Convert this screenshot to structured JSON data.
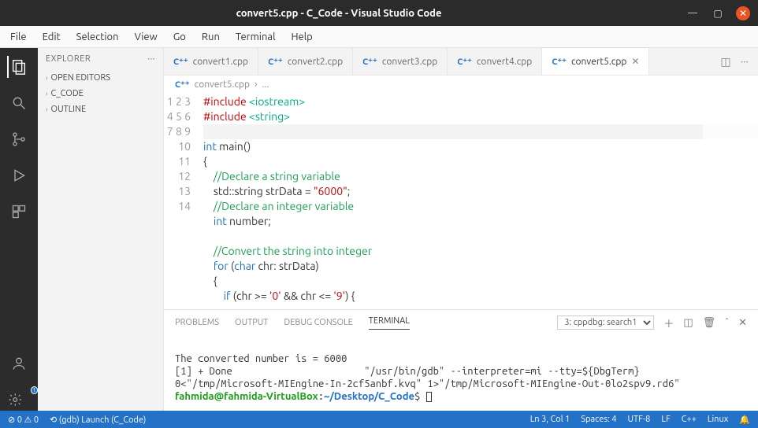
{
  "window": {
    "title": "convert5.cpp - C_Code - Visual Studio Code"
  },
  "menu": [
    "File",
    "Edit",
    "Selection",
    "View",
    "Go",
    "Run",
    "Terminal",
    "Help"
  ],
  "explorer": {
    "title": "EXPLORER",
    "sections": [
      "OPEN EDITORS",
      "C_CODE",
      "OUTLINE"
    ]
  },
  "tabs": [
    {
      "label": "convert1.cpp",
      "active": false
    },
    {
      "label": "convert2.cpp",
      "active": false
    },
    {
      "label": "convert3.cpp",
      "active": false
    },
    {
      "label": "convert4.cpp",
      "active": false
    },
    {
      "label": "convert5.cpp",
      "active": true
    }
  ],
  "breadcrumb": {
    "file": "convert5.cpp",
    "sep": "›",
    "rest": "..."
  },
  "code_lines": [
    {
      "n": 1,
      "html": "<span class='k-pre'>#include</span> <span class='k-incstr'>&lt;iostream&gt;</span>"
    },
    {
      "n": 2,
      "html": "<span class='k-pre'>#include</span> <span class='k-incstr'>&lt;string&gt;</span>"
    },
    {
      "n": 3,
      "html": "<span class='cur-line'>&#8203;</span>"
    },
    {
      "n": 4,
      "html": "<span class='k-type'>int</span> main()"
    },
    {
      "n": 5,
      "html": "{"
    },
    {
      "n": 6,
      "html": "    <span class='k-com'>//Declare a string variable</span>"
    },
    {
      "n": 7,
      "html": "    std::string strData = <span class='k-str'>\"6000\"</span>;"
    },
    {
      "n": 8,
      "html": "    <span class='k-com'>//Declare an integer variable</span>"
    },
    {
      "n": 9,
      "html": "    <span class='k-type'>int</span> number;"
    },
    {
      "n": 10,
      "html": ""
    },
    {
      "n": 11,
      "html": "    <span class='k-com'>//Convert the string into integer</span>"
    },
    {
      "n": 12,
      "html": "    <span class='k-type'>for</span> (<span class='k-type'>char</span> chr: strData)"
    },
    {
      "n": 13,
      "html": "    {"
    },
    {
      "n": 14,
      "html": "        <span class='k-type'>if</span> (chr &gt;= <span class='k-chr'>'0'</span> &amp;&amp; chr &lt;= <span class='k-chr'>'9'</span>) {"
    }
  ],
  "panel": {
    "tabs": [
      "PROBLEMS",
      "OUTPUT",
      "DEBUG CONSOLE",
      "TERMINAL"
    ],
    "active_tab": "TERMINAL",
    "selector": "3: cppdbg: search1",
    "terminal_lines": [
      "",
      "The converted number is = 6000",
      "[1] + Done                       \"/usr/bin/gdb\" --interpreter=mi --tty=${DbgTerm} 0<\"/tmp/Microsoft-MIEngine-In-2cf5anbf.kvq\" 1>\"/tmp/Microsoft-MIEngine-Out-0lo2spv9.rd6\""
    ],
    "prompt": {
      "user": "fahmida@fahmida-VirtualBox",
      "sep": ":",
      "path": "~/Desktop/C_Code",
      "end": "$"
    }
  },
  "status": {
    "left": [
      "⊘ 0 ⚠ 0",
      "⟲ (gdb) Launch (C_Code)"
    ],
    "right": [
      "Ln 3, Col 1",
      "Spaces: 4",
      "UTF-8",
      "LF",
      "C++",
      "Linux",
      "🔔"
    ]
  }
}
